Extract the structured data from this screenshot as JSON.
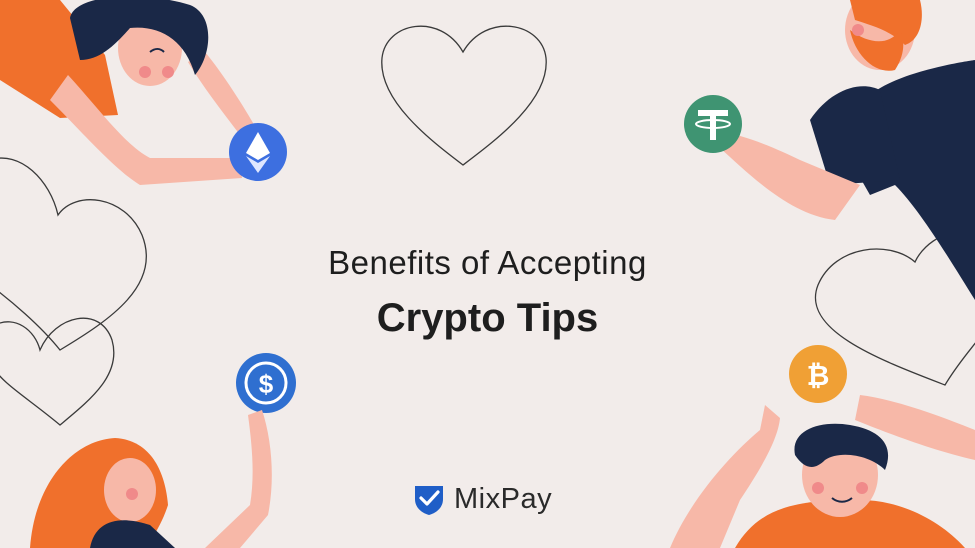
{
  "headline": {
    "line1": "Benefits of Accepting",
    "line2": "Crypto Tips"
  },
  "brand": {
    "name": "MixPay",
    "logo_icon": "shield-check-icon",
    "logo_color": "#1f5ec7"
  },
  "coins": [
    {
      "name": "ethereum-coin-icon",
      "color": "#3d6fe0"
    },
    {
      "name": "tether-coin-icon",
      "color": "#3f9472"
    },
    {
      "name": "usd-coin-icon",
      "color": "#2f6fd0"
    },
    {
      "name": "bitcoin-coin-icon",
      "color": "#f0a035"
    }
  ],
  "colors": {
    "background": "#f2ecea",
    "skin": "#f7b8a8",
    "orange": "#f0702c",
    "navy": "#1a2847"
  }
}
